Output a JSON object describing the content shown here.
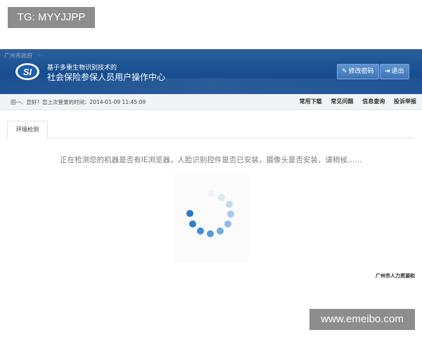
{
  "watermarks": {
    "top": "TG: MYYJJPP",
    "bottom": "www.emeibo.com"
  },
  "header": {
    "top_links": [
      "广州市政府",
      "···"
    ],
    "logo_text": "SI",
    "slogan_line1": "基于多重生物识别技术的",
    "slogan_line2": "社会保险参保人员用户操作中心",
    "change_password": "修改密码",
    "logout": "退出"
  },
  "subbar": {
    "greeting": "田一、您好！您上次登录的时间：2014-01-09 11:45:09",
    "nav": [
      "常用下载",
      "常见问题",
      "信息查询",
      "投诉举报"
    ]
  },
  "tabs": [
    {
      "label": "环境检测"
    }
  ],
  "status_message": "正在检测您的机器是否有IE浏览器，人脸识别控件是否已安装，摄像头是否安装，请稍候……",
  "footer": {
    "org": "广州市人力资源和"
  },
  "colors": {
    "header_blue": "#1a4f91",
    "spinner_blue": "#2e7fd0"
  }
}
